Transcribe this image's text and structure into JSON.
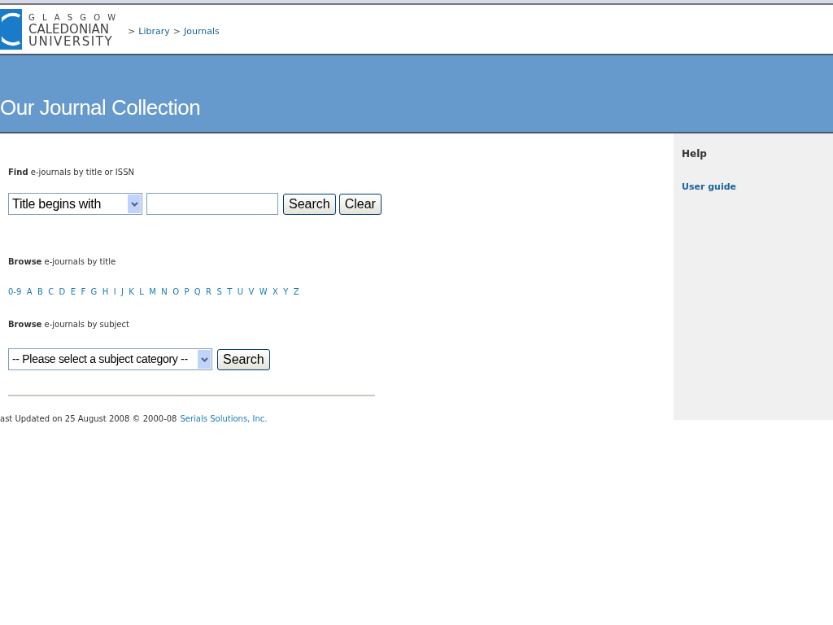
{
  "logo": {
    "line_1": "G L A S G O W",
    "line_2": "CALEDONIAN",
    "line_3": "UNIVERSITY"
  },
  "breadcrumb": [
    {
      "separator": ">",
      "label": "Library"
    },
    {
      "separator": ">",
      "label": "Journals"
    }
  ],
  "banner": {
    "title": "Our Journal Collection"
  },
  "find": {
    "heading": "**Find** e-journals by title or ISSN",
    "select": "Title begins with",
    "buttons": [
      "Search",
      "Clear"
    ]
  },
  "browse_title": {
    "heading": "**Browse** e-journals by title",
    "letters": [
      "0-9",
      "A",
      "B",
      "C",
      "D",
      "E",
      "F",
      "G",
      "H",
      "I",
      "J",
      "K",
      "L",
      "M",
      "N",
      "O",
      "P",
      "Q",
      "R",
      "S",
      "T",
      "U",
      "V",
      "W",
      "X",
      "Y",
      "Z"
    ]
  },
  "browse_subject": {
    "heading": "**Browse** e-journals by subject",
    "select": "-- Please select a subject category --",
    "button": "Search"
  },
  "footer": {
    "text": "ast Updated on 25 August 2008 © 2000-08",
    "link": "Serials Solutions, Inc."
  },
  "sidebar": {
    "title": "Help",
    "links": [
      "User guide"
    ]
  }
}
